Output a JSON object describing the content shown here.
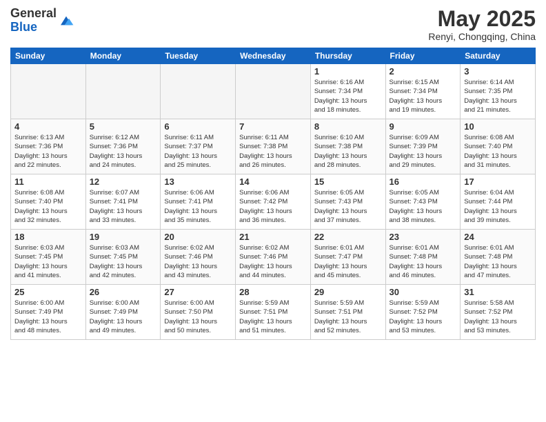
{
  "header": {
    "logo_line1": "General",
    "logo_line2": "Blue",
    "month_title": "May 2025",
    "location": "Renyi, Chongqing, China"
  },
  "weekdays": [
    "Sunday",
    "Monday",
    "Tuesday",
    "Wednesday",
    "Thursday",
    "Friday",
    "Saturday"
  ],
  "weeks": [
    [
      {
        "day": "",
        "info": ""
      },
      {
        "day": "",
        "info": ""
      },
      {
        "day": "",
        "info": ""
      },
      {
        "day": "",
        "info": ""
      },
      {
        "day": "1",
        "info": "Sunrise: 6:16 AM\nSunset: 7:34 PM\nDaylight: 13 hours\nand 18 minutes."
      },
      {
        "day": "2",
        "info": "Sunrise: 6:15 AM\nSunset: 7:34 PM\nDaylight: 13 hours\nand 19 minutes."
      },
      {
        "day": "3",
        "info": "Sunrise: 6:14 AM\nSunset: 7:35 PM\nDaylight: 13 hours\nand 21 minutes."
      }
    ],
    [
      {
        "day": "4",
        "info": "Sunrise: 6:13 AM\nSunset: 7:36 PM\nDaylight: 13 hours\nand 22 minutes."
      },
      {
        "day": "5",
        "info": "Sunrise: 6:12 AM\nSunset: 7:36 PM\nDaylight: 13 hours\nand 24 minutes."
      },
      {
        "day": "6",
        "info": "Sunrise: 6:11 AM\nSunset: 7:37 PM\nDaylight: 13 hours\nand 25 minutes."
      },
      {
        "day": "7",
        "info": "Sunrise: 6:11 AM\nSunset: 7:38 PM\nDaylight: 13 hours\nand 26 minutes."
      },
      {
        "day": "8",
        "info": "Sunrise: 6:10 AM\nSunset: 7:38 PM\nDaylight: 13 hours\nand 28 minutes."
      },
      {
        "day": "9",
        "info": "Sunrise: 6:09 AM\nSunset: 7:39 PM\nDaylight: 13 hours\nand 29 minutes."
      },
      {
        "day": "10",
        "info": "Sunrise: 6:08 AM\nSunset: 7:40 PM\nDaylight: 13 hours\nand 31 minutes."
      }
    ],
    [
      {
        "day": "11",
        "info": "Sunrise: 6:08 AM\nSunset: 7:40 PM\nDaylight: 13 hours\nand 32 minutes."
      },
      {
        "day": "12",
        "info": "Sunrise: 6:07 AM\nSunset: 7:41 PM\nDaylight: 13 hours\nand 33 minutes."
      },
      {
        "day": "13",
        "info": "Sunrise: 6:06 AM\nSunset: 7:41 PM\nDaylight: 13 hours\nand 35 minutes."
      },
      {
        "day": "14",
        "info": "Sunrise: 6:06 AM\nSunset: 7:42 PM\nDaylight: 13 hours\nand 36 minutes."
      },
      {
        "day": "15",
        "info": "Sunrise: 6:05 AM\nSunset: 7:43 PM\nDaylight: 13 hours\nand 37 minutes."
      },
      {
        "day": "16",
        "info": "Sunrise: 6:05 AM\nSunset: 7:43 PM\nDaylight: 13 hours\nand 38 minutes."
      },
      {
        "day": "17",
        "info": "Sunrise: 6:04 AM\nSunset: 7:44 PM\nDaylight: 13 hours\nand 39 minutes."
      }
    ],
    [
      {
        "day": "18",
        "info": "Sunrise: 6:03 AM\nSunset: 7:45 PM\nDaylight: 13 hours\nand 41 minutes."
      },
      {
        "day": "19",
        "info": "Sunrise: 6:03 AM\nSunset: 7:45 PM\nDaylight: 13 hours\nand 42 minutes."
      },
      {
        "day": "20",
        "info": "Sunrise: 6:02 AM\nSunset: 7:46 PM\nDaylight: 13 hours\nand 43 minutes."
      },
      {
        "day": "21",
        "info": "Sunrise: 6:02 AM\nSunset: 7:46 PM\nDaylight: 13 hours\nand 44 minutes."
      },
      {
        "day": "22",
        "info": "Sunrise: 6:01 AM\nSunset: 7:47 PM\nDaylight: 13 hours\nand 45 minutes."
      },
      {
        "day": "23",
        "info": "Sunrise: 6:01 AM\nSunset: 7:48 PM\nDaylight: 13 hours\nand 46 minutes."
      },
      {
        "day": "24",
        "info": "Sunrise: 6:01 AM\nSunset: 7:48 PM\nDaylight: 13 hours\nand 47 minutes."
      }
    ],
    [
      {
        "day": "25",
        "info": "Sunrise: 6:00 AM\nSunset: 7:49 PM\nDaylight: 13 hours\nand 48 minutes."
      },
      {
        "day": "26",
        "info": "Sunrise: 6:00 AM\nSunset: 7:49 PM\nDaylight: 13 hours\nand 49 minutes."
      },
      {
        "day": "27",
        "info": "Sunrise: 6:00 AM\nSunset: 7:50 PM\nDaylight: 13 hours\nand 50 minutes."
      },
      {
        "day": "28",
        "info": "Sunrise: 5:59 AM\nSunset: 7:51 PM\nDaylight: 13 hours\nand 51 minutes."
      },
      {
        "day": "29",
        "info": "Sunrise: 5:59 AM\nSunset: 7:51 PM\nDaylight: 13 hours\nand 52 minutes."
      },
      {
        "day": "30",
        "info": "Sunrise: 5:59 AM\nSunset: 7:52 PM\nDaylight: 13 hours\nand 53 minutes."
      },
      {
        "day": "31",
        "info": "Sunrise: 5:58 AM\nSunset: 7:52 PM\nDaylight: 13 hours\nand 53 minutes."
      }
    ]
  ]
}
